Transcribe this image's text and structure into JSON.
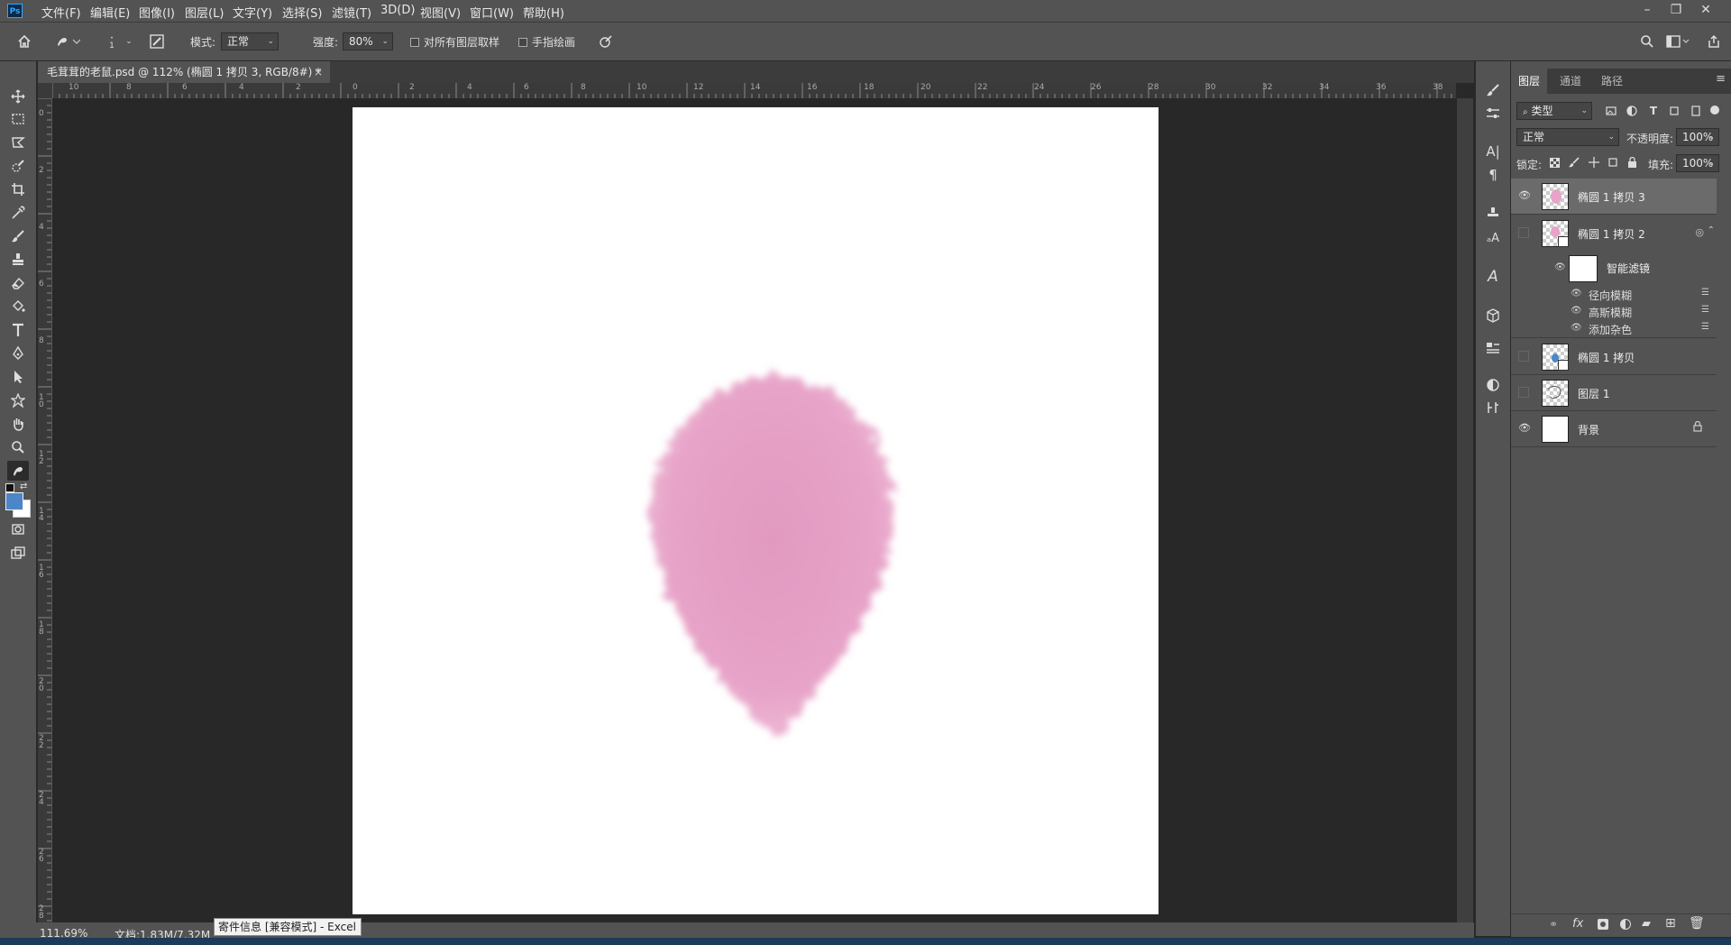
{
  "app": {
    "logo": "Ps"
  },
  "menu": [
    "文件(F)",
    "编辑(E)",
    "图像(I)",
    "图层(L)",
    "文字(Y)",
    "选择(S)",
    "滤镜(T)",
    "3D(D)",
    "视图(V)",
    "窗口(W)",
    "帮助(H)"
  ],
  "window_buttons": {
    "minimize": "–",
    "restore": "❐",
    "close": "✕"
  },
  "options": {
    "brush_size": "1",
    "mode_label": "模式:",
    "mode_value": "正常",
    "strength_label": "强度:",
    "strength_value": "80%",
    "sample_all_label": "对所有图层取样",
    "finger_paint_label": "手指绘画"
  },
  "document": {
    "tab_title": "毛茸茸的老鼠.psd @ 112% (椭圆 1 拷贝 3, RGB/8#) *",
    "tab_close": "×"
  },
  "ruler": {
    "top_ticks": [
      "10",
      "8",
      "6",
      "4",
      "2",
      "0",
      "2",
      "4",
      "6",
      "8",
      "10",
      "12",
      "14",
      "16",
      "18",
      "20",
      "22",
      "24",
      "26",
      "28",
      "30",
      "32",
      "34",
      "36",
      "38"
    ],
    "left_ticks": [
      "0",
      "2",
      "4",
      "6",
      "8",
      "1 0",
      "1 2",
      "1 4",
      "1 6",
      "1 8",
      "2 0",
      "2 2",
      "2 4",
      "2 6",
      "2 8"
    ]
  },
  "status": {
    "zoom": "111.69%",
    "doc_info": "文档:1.83M/7.32M",
    "excel_tooltip": "寄件信息 [兼容模式] - Excel"
  },
  "layers_panel": {
    "tabs": [
      "图层",
      "通道",
      "路径"
    ],
    "filter_kind": "类型",
    "blend_mode": "正常",
    "opacity_label": "不透明度:",
    "opacity_value": "100%",
    "lock_label": "锁定:",
    "fill_label": "填充:",
    "fill_value": "100%",
    "layers": [
      {
        "name": "椭圆 1 拷贝 3",
        "visible": true,
        "selected": true
      },
      {
        "name": "椭圆 1 拷贝 2",
        "visible": false,
        "selected": false
      },
      {
        "name": "椭圆 1 拷贝",
        "visible": false,
        "selected": false
      },
      {
        "name": "图层 1",
        "visible": false,
        "selected": false
      },
      {
        "name": "背景",
        "visible": true,
        "selected": false
      }
    ],
    "smart_filters_label": "智能滤镜",
    "smart_filters": [
      "径向模糊",
      "高斯模糊",
      "添加杂色"
    ]
  },
  "colors": {
    "fur_pink": "#e7a3c8",
    "foreground_swatch": "#4d86c8",
    "background_swatch": "#ffffff"
  }
}
